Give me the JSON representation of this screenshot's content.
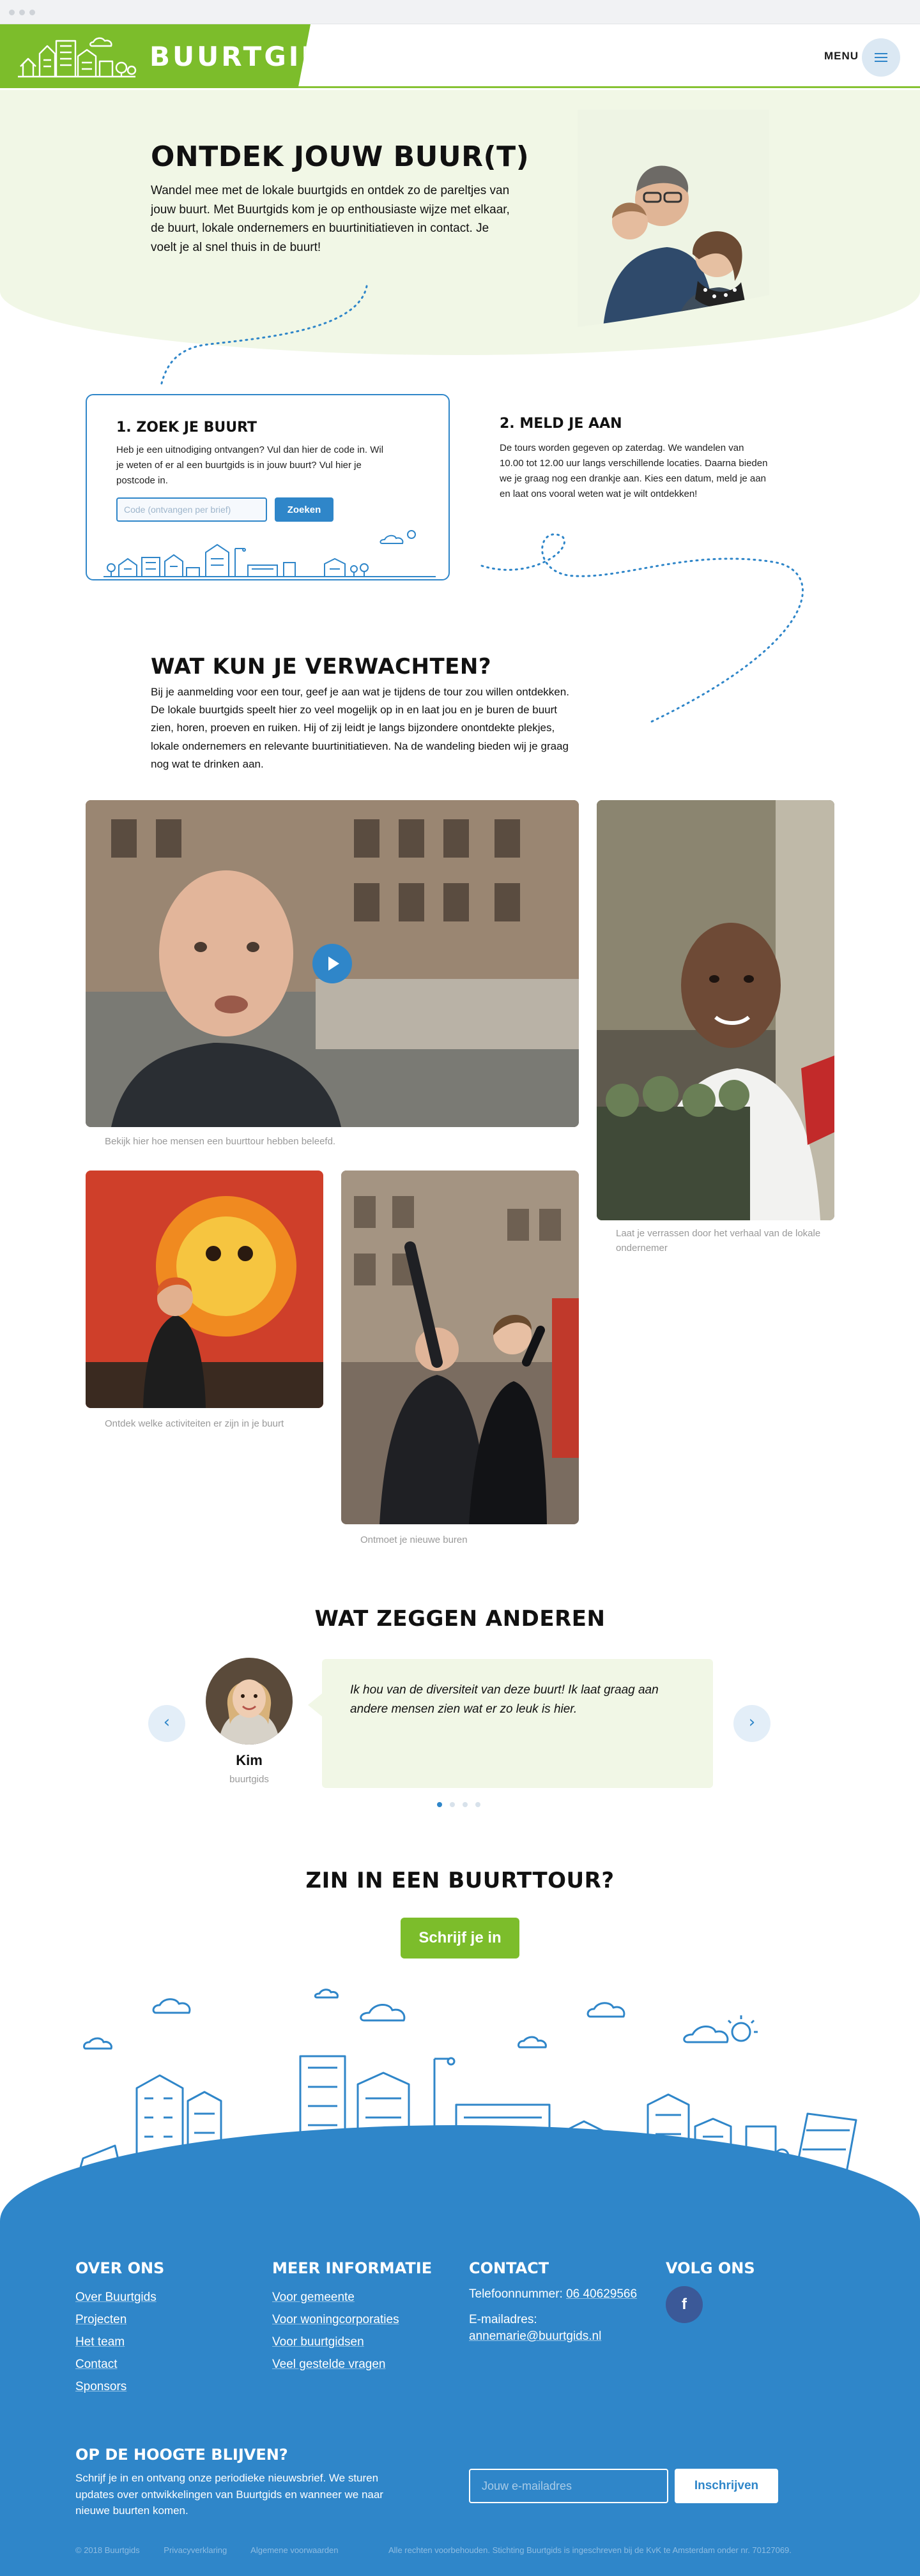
{
  "header": {
    "logo_text": "BUURTGIDS",
    "menu_label": "MENU"
  },
  "hero": {
    "title": "ONTDEK JOUW BUUR(T)",
    "text": "Wandel mee met de lokale buurtgids en ontdek zo de pareltjes van jouw buurt. Met Buurtgids kom je op enthousiaste wijze met elkaar, de buurt, lokale ondernemers en buurtinitiatieven in contact. Je voelt je al snel thuis in de buurt!"
  },
  "step1": {
    "title": "1. ZOEK JE BUURT",
    "text": "Heb je een uitnodiging ontvangen? Vul dan hier de code in. Wil je weten of er al een buurtgids is in jouw buurt? Vul hier je postcode in.",
    "input_placeholder": "Code (ontvangen per brief)",
    "button_label": "Zoeken"
  },
  "step2": {
    "title": "2. MELD JE AAN",
    "text": "De tours worden gegeven op zaterdag. We wandelen van 10.00 tot 12.00 uur langs verschillende locaties. Daarna bieden we je graag nog een drankje aan. Kies een datum, meld je aan en laat ons vooral weten wat je wilt ontdekken!"
  },
  "expect": {
    "title": "WAT KUN JE VERWACHTEN?",
    "text": "Bij je aanmelding voor een tour, geef je aan wat je tijdens de tour zou willen ontdekken. De lokale buurtgids speelt hier zo veel mogelijk op in en laat jou en je buren de buurt zien, horen, proeven en ruiken. Hij of zij leidt je langs bijzondere onontdekte plekjes, lokale ondernemers en relevante buurtinitiatieven. Na de wandeling bieden wij je graag nog wat te drinken aan."
  },
  "gallery": {
    "captions": [
      "Bekijk hier hoe mensen een buurttour hebben beleefd.",
      "Laat je verrassen door het verhaal van de lokale ondernemer",
      "Ontdek welke activiteiten er zijn in je buurt",
      "Ontmoet je nieuwe buren"
    ]
  },
  "testimonials": {
    "title": "WAT ZEGGEN ANDEREN",
    "name": "Kim",
    "role": "buurtgids",
    "quote": "Ik hou van de diversiteit van deze buurt! Ik laat graag aan andere mensen zien wat er zo leuk is hier.",
    "prev_icon": "chevron-left-icon",
    "next_icon": "chevron-right-icon"
  },
  "cta": {
    "title": "ZIN IN EEN BUURTTOUR?",
    "button_label": "Schrijf je in"
  },
  "footer": {
    "col1": {
      "title": "OVER ONS",
      "links": [
        "Over Buurtgids",
        "Projecten",
        "Het team",
        "Contact",
        "Sponsors"
      ]
    },
    "col2": {
      "title": "MEER INFORMATIE",
      "links": [
        "Voor gemeente",
        "Voor woningcorporaties",
        "Voor buurtgidsen",
        "Veel gestelde vragen"
      ]
    },
    "col3": {
      "title": "CONTACT",
      "phone_label": "Telefoonnummer:",
      "phone": "06 40629566",
      "email_label": "E-mailadres:",
      "email": "annemarie@buurtgids.nl"
    },
    "col4": {
      "title": "VOLG ONS",
      "facebook": "f"
    },
    "newsletter": {
      "title": "OP DE HOOGTE BLIJVEN?",
      "text": "Schrijf je in en ontvang onze periodieke nieuwsbrief. We sturen updates over ontwikkelingen van Buurtgids en wanneer we naar nieuwe buurten komen.",
      "input_placeholder": "Jouw e-mailadres",
      "button_label": "Inschrijven"
    },
    "copyright": "© 2018 Buurtgids",
    "privacy": "Privacyverklaring",
    "terms": "Algemene voorwaarden",
    "legal": "Alle rechten voorbehouden. Stichting Buurtgids is ingeschreven bij de KvK te Amsterdam onder nr. 70127069."
  },
  "colors": {
    "green": "#7cbd2b",
    "blue": "#2f86c9",
    "light_green": "#f1f7e6"
  }
}
